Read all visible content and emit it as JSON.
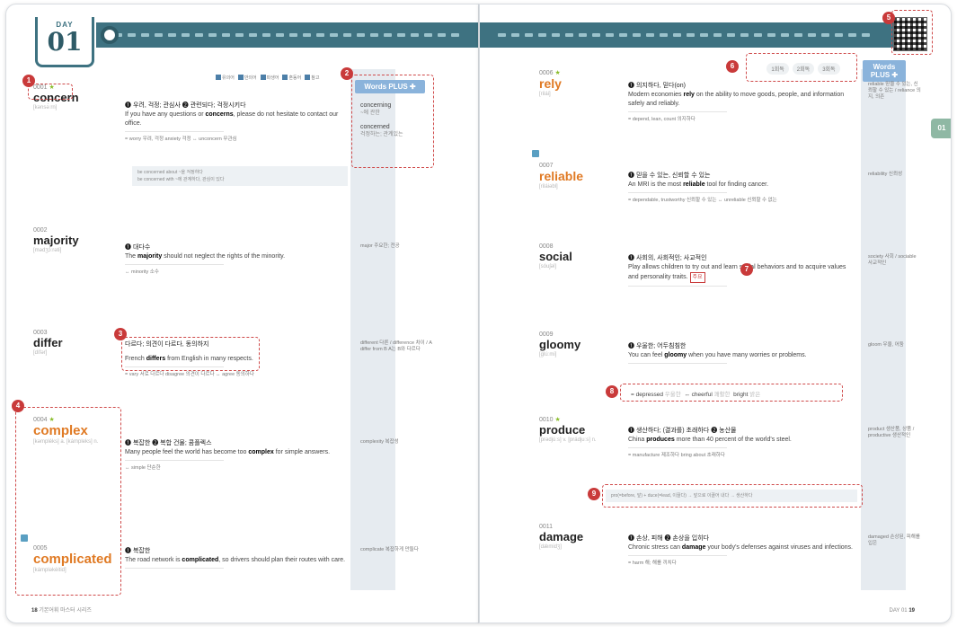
{
  "day": {
    "label": "DAY",
    "number": "01"
  },
  "legend": [
    "유의어",
    "반의어",
    "파생어",
    "혼동어",
    "참고"
  ],
  "words_plus_label": "Words PLUS ✚",
  "review": [
    "1회독",
    "2회독",
    "3회독"
  ],
  "chip_label": "01",
  "left_entries": [
    {
      "num": "0001",
      "starred": true,
      "word": "concern",
      "pron": "[kənsə́ːrn]",
      "def": "❶ 우려, 걱정; 관심사 ❷ 관련되다; 걱정시키다",
      "example": [
        "If you have any questions or ",
        "concerns",
        ", please do not hesitate to contact our office."
      ],
      "syn": "= worry 우려, 걱정   anxiety 걱정   ↔ unconcern 무관심",
      "note": [
        "be concerned about ~을 걱정하다",
        "be concerned with ~에 관계하다, 관심이 있다"
      ],
      "plus": [
        {
          "w": "concerning",
          "k": "~에 관한"
        },
        {
          "w": "concerned",
          "k": "걱정하는; 관계있는"
        }
      ]
    },
    {
      "num": "0002",
      "word": "majority",
      "pron": "[mədʒɔ́ːrəti]",
      "def": "❶ 대다수",
      "example": [
        "The ",
        "majority",
        " should not neglect the rights of the minority."
      ],
      "syn": "↔ minority 소수",
      "side": "major 주요한; 전공"
    },
    {
      "num": "0003",
      "word": "differ",
      "pron": "[dífər]",
      "def": "다르다; 의견이 다르다, 동의하지",
      "example": [
        "French ",
        "differs",
        " from English in many respects."
      ],
      "syn": "= vary 서로 다르다   disagree 의견이 다르다   ↔ agree 동의하다",
      "side": "different 다른 / difference 차이 / A differ from B A는 B와 다르다"
    },
    {
      "num": "0004",
      "starred": true,
      "word": "complex",
      "pron": "[kəmpléks] a. [kámpleks] n.",
      "def": "❶ 복잡한 ❷ 복합 건물; 콤플렉스",
      "example": [
        "Many people feel the world has become too ",
        "complex",
        " for simple answers."
      ],
      "syn": "↔ simple 단순한",
      "side": "complexity 복잡성"
    },
    {
      "num": "0005",
      "word": "complicated",
      "pron": "[kámpləkèitid]",
      "def": "❶ 복잡한",
      "example": [
        "The road network is ",
        "complicated",
        ", so drivers should plan their routes with care."
      ],
      "syn": "",
      "side": "complicate 복잡하게 만들다"
    }
  ],
  "right_entries": [
    {
      "num": "0006",
      "starred": true,
      "word": "rely",
      "pron": "[rilái]",
      "def": "❶ 의지하다, 믿다(on)",
      "example": [
        "Modern economies ",
        "rely",
        " on the ability to move goods, people, and information safely and reliably."
      ],
      "syn": "= depend, lean, count 의지하다",
      "side": "reliable 믿을 수 있는, 신뢰할 수 있는 / reliance 의지, 의존"
    },
    {
      "num": "0007",
      "word": "reliable",
      "pron": "[riláiəbl]",
      "def": "❶ 믿을 수 있는, 신뢰할 수 있는",
      "example": [
        "An MRI is the most ",
        "reliable",
        " tool for finding cancer."
      ],
      "syn": "= dependable, trustworthy 신뢰할 수 있는   ↔ unreliable 신뢰할 수 없는",
      "side": "reliability 신뢰성"
    },
    {
      "num": "0008",
      "word": "social",
      "pron": "[sóuʃəl]",
      "def": "❶ 사회의, 사회적인; 사교적인",
      "example": [
        "Play allows children to try out and learn social behaviors and to acquire values and personality traits."
      ],
      "stamp": "주요",
      "syn": "",
      "side": "society 사회 / sociable 사교적인"
    },
    {
      "num": "0009",
      "word": "gloomy",
      "pron": "[glúːmi]",
      "def": "❶ 우울한; 어두침침한",
      "example": [
        "You can feel ",
        "gloomy",
        " when you have many worries or problems."
      ],
      "syn_box": [
        {
          "w": "depressed",
          "k": "우울한"
        },
        {
          "w": "cheerful",
          "k": "쾌활한"
        },
        {
          "w": "bright",
          "k": "밝은"
        }
      ],
      "side": "gloom 우울, 어둠"
    },
    {
      "num": "0010",
      "starred": true,
      "word": "produce",
      "pron": "[prədjúːs] v. [prádjuːs] n.",
      "def": "❶ 생산하다; (결과를) 초래하다 ❷ 농산물",
      "example": [
        "China ",
        "produces",
        " more than 40 percent of the world's steel."
      ],
      "syn": "= manufacture 제조하다   bring about 초래하다",
      "etym": "pro(=before, 앞) + duce(=lead, 이끌다) → 앞으로 이끌어 내다 → 생산하다",
      "side": "product 생산품, 상품 / productive 생산적인"
    },
    {
      "num": "0011",
      "word": "damage",
      "pron": "[dǽmidʒ]",
      "def": "❶ 손상, 피해 ❷ 손상을 입히다",
      "example": [
        "Chronic stress can ",
        "damage",
        " your body's defenses against viruses and infections."
      ],
      "syn": "= harm 해; 해를 끼치다",
      "side": "damaged 손상된, 피해를 입은"
    }
  ],
  "footer": {
    "left_page": "18",
    "left_title": "기본어휘 마스터 시리즈",
    "right_title": "DAY 01",
    "right_page": "19"
  },
  "markers": [
    "1",
    "2",
    "3",
    "4",
    "5",
    "6",
    "7",
    "8",
    "9"
  ],
  "colors": {
    "band": "#3e7281",
    "accent_orange": "#e07a24",
    "marker_red": "#c93a3a",
    "words_plus": "#8ab3db"
  }
}
